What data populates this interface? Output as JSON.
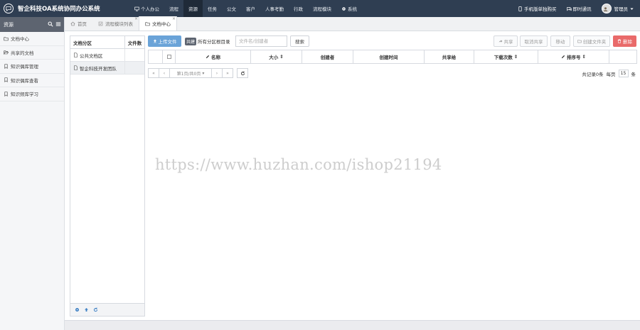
{
  "app": {
    "title": "智企科技OA系统协同办公系统"
  },
  "nav": {
    "items": [
      {
        "label": "个人办公",
        "icon": "monitor-icon"
      },
      {
        "label": "流程"
      },
      {
        "label": "资源"
      },
      {
        "label": "任务"
      },
      {
        "label": "公文"
      },
      {
        "label": "客户"
      },
      {
        "label": "人事考勤"
      },
      {
        "label": "行政"
      },
      {
        "label": "流程模块"
      },
      {
        "label": "系统",
        "icon": "gear-icon"
      }
    ],
    "active_index": 2
  },
  "topright": {
    "mobile_label": "手机版单独购买",
    "im_label": "即时通讯",
    "user_label": "管理员"
  },
  "sidebar": {
    "title": "资源",
    "items": [
      {
        "label": "文档中心",
        "icon": "folder-icon"
      },
      {
        "label": "共享的文档",
        "icon": "folder-open-icon"
      },
      {
        "label": "知识偶库管理",
        "icon": "bookmark-icon"
      },
      {
        "label": "知识偶库查看",
        "icon": "bookmark-icon"
      },
      {
        "label": "知识频库学习",
        "icon": "bookmark-icon"
      }
    ]
  },
  "tabs": [
    {
      "label": "首页",
      "icon": "home-icon",
      "closable": false
    },
    {
      "label": "流程模块列表",
      "icon": "check-square-icon",
      "closable": true
    },
    {
      "label": "文档中心",
      "icon": "folder-icon",
      "closable": true
    }
  ],
  "tabs_active_index": 2,
  "doc_panel": {
    "headers": {
      "partition": "文档分区",
      "count": "文件数"
    },
    "rows": [
      {
        "label": "公共文档区",
        "count": ""
      },
      {
        "label": "智企科技开发团队",
        "count": ""
      }
    ],
    "selected_index": 1
  },
  "toolbar": {
    "upload_label": "上传文件",
    "share_badge": "共建",
    "all_folders_label": "所有分区根目录",
    "search_placeholder": "文件名/创建者",
    "search_label": "搜索",
    "share_label": "共享",
    "unshare_label": "取消共享",
    "move_label": "移动",
    "newfolder_label": "创建文件夹",
    "delete_label": "删除"
  },
  "grid": {
    "headers": [
      "名称",
      "大小",
      "创建者",
      "创建时间",
      "共享给",
      "下载次数",
      "排序号"
    ]
  },
  "pager": {
    "first": "«",
    "prev": "‹",
    "page_label": "第1页/共0页",
    "next": "›",
    "last": "»",
    "total_label": "共记录0条",
    "per_page_label": "每页",
    "per_page_value": "15",
    "per_page_unit": "条"
  },
  "watermark": "https://www.huzhan.com/ishop21194"
}
